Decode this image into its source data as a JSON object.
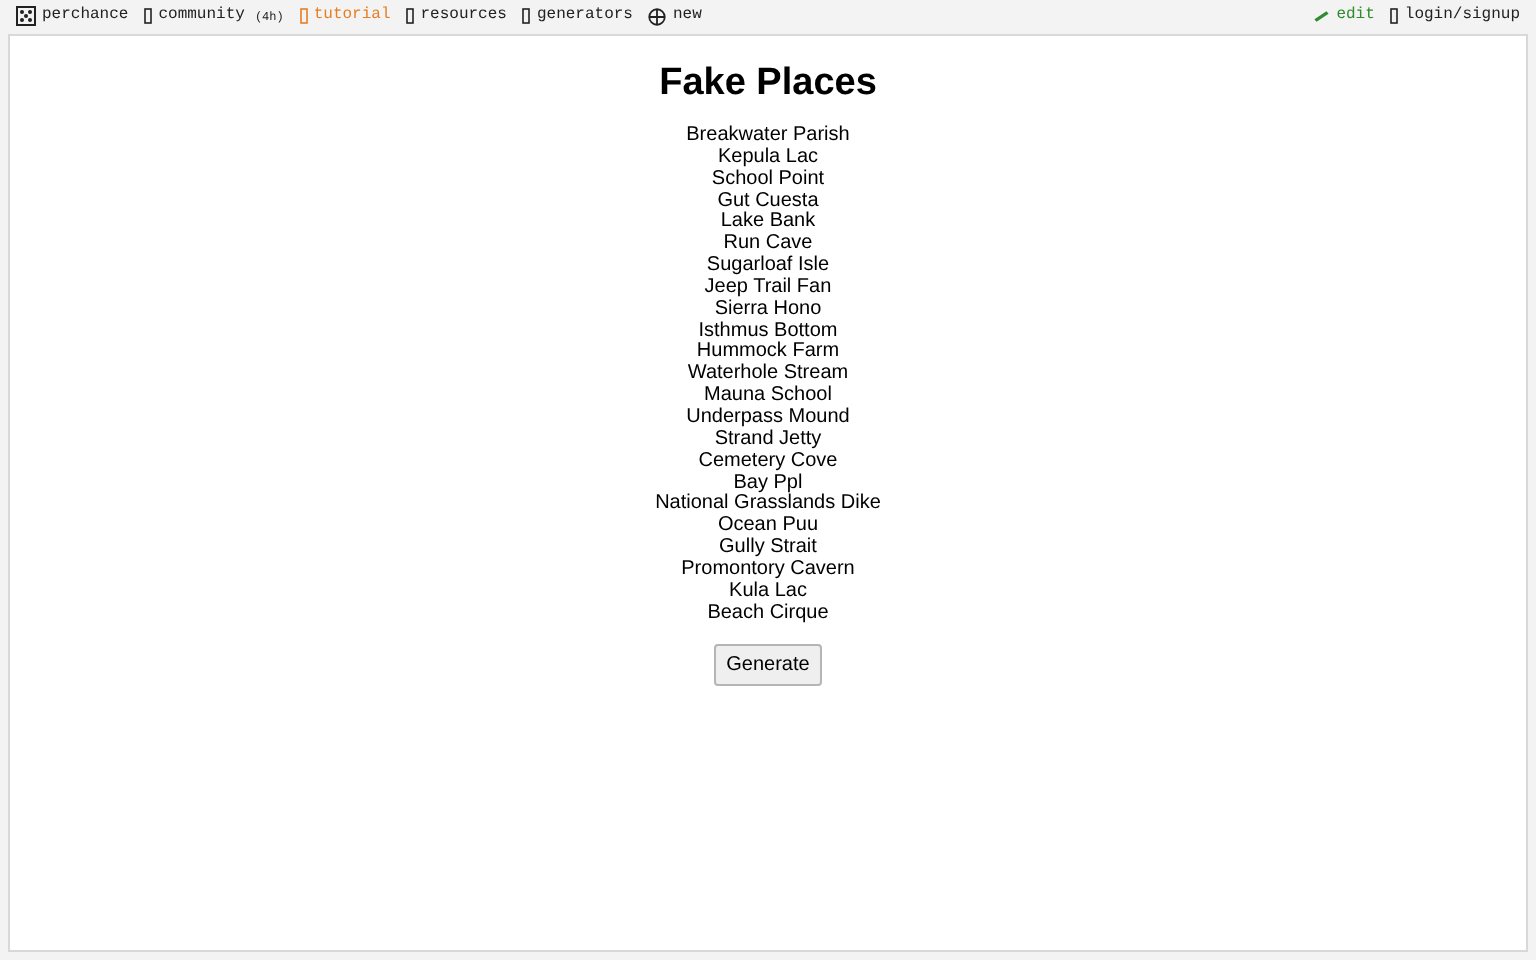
{
  "nav": {
    "left": [
      {
        "kind": "dice",
        "label": "perchance",
        "color": "#222222"
      },
      {
        "kind": "box",
        "label": "community",
        "note": "(4h)",
        "color": "#222222"
      },
      {
        "kind": "box",
        "label": "tutorial",
        "color": "#e67e22"
      },
      {
        "kind": "box",
        "label": "resources",
        "color": "#222222"
      },
      {
        "kind": "box",
        "label": "generators",
        "color": "#222222"
      },
      {
        "kind": "plus",
        "label": "new",
        "color": "#222222"
      }
    ],
    "right": [
      {
        "kind": "pencil",
        "label": "edit",
        "color": "#2e8b2e"
      },
      {
        "kind": "box",
        "label": "login/signup",
        "color": "#222222"
      }
    ]
  },
  "title": "Fake Places",
  "places": [
    "Breakwater Parish",
    "Kepula Lac",
    "School Point",
    "Gut Cuesta",
    "Lake Bank",
    "Run Cave",
    "Sugarloaf Isle",
    "Jeep Trail Fan",
    "Sierra Hono",
    "Isthmus Bottom",
    "Hummock Farm",
    "Waterhole Stream",
    "Mauna School",
    "Underpass Mound",
    "Strand Jetty",
    "Cemetery Cove",
    "Bay Ppl",
    "National Grasslands Dike",
    "Ocean Puu",
    "Gully Strait",
    "Promontory Cavern",
    "Kula Lac",
    "Beach Cirque"
  ],
  "button": "Generate"
}
